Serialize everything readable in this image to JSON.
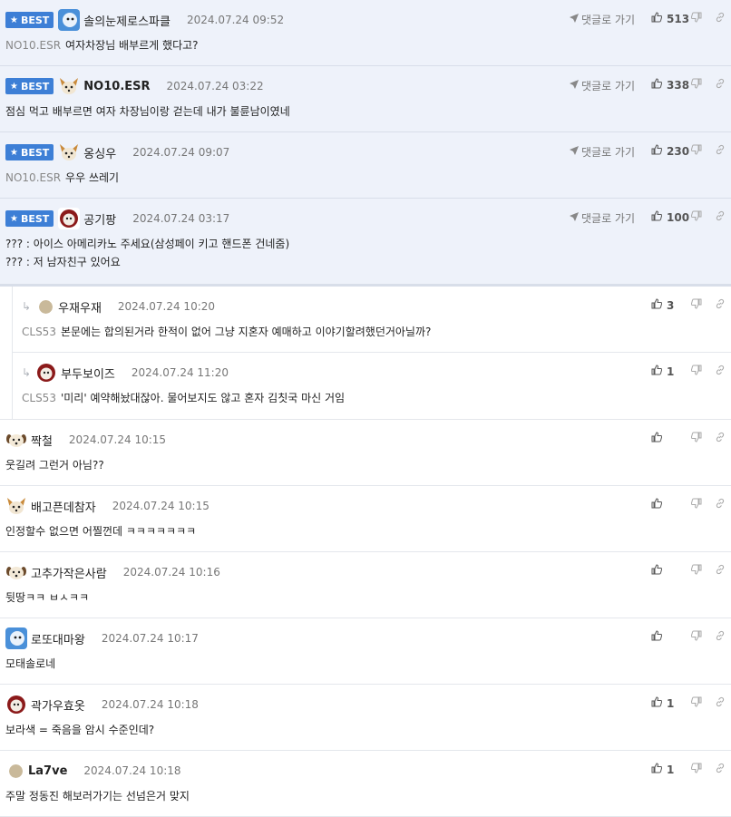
{
  "best_badge": "BEST",
  "reply_link_label": "댓글로 가기",
  "comments": [
    {
      "best": true,
      "nick": "솔의눈제로스파클",
      "date": "2024.07.24 09:52",
      "likes": "513",
      "to": "NO10.ESR",
      "lines": [
        "여자차장님 배부르게 했다고?"
      ],
      "avatar": "blue"
    },
    {
      "best": true,
      "nick": "NO10.ESR",
      "date": "2024.07.24 03:22",
      "likes": "338",
      "to": "",
      "lines": [
        "점심 먹고 배부르면 여자 차장님이랑 걷는데 내가 불륜남이였네"
      ],
      "avatar": "fox"
    },
    {
      "best": true,
      "nick": "옹싱우",
      "date": "2024.07.24 09:07",
      "likes": "230",
      "to": "NO10.ESR",
      "lines": [
        "우우 쓰레기"
      ],
      "avatar": "fox"
    },
    {
      "best": true,
      "nick": "공기팡",
      "date": "2024.07.24 03:17",
      "likes": "100",
      "to": "",
      "lines": [
        "??? : 아이스 아메리카노 주세요(삼성페이 키고 핸드폰 건네줌)",
        "??? : 저 남자친구 있어요"
      ],
      "avatar": "red"
    }
  ],
  "replies": [
    {
      "nick": "우재우재",
      "date": "2024.07.24 10:20",
      "likes": "3",
      "to": "CLS53",
      "text": "본문에는 합의된거라 한적이 없어 그냥 지혼자 예매하고 이야기할려했던거아닐까?",
      "avatar": "dot"
    },
    {
      "nick": "부두보이즈",
      "date": "2024.07.24 11:20",
      "likes": "1",
      "to": "CLS53",
      "text": "'미리' 예약해놨대잖아. 물어보지도 않고 혼자 김칫국 마신 거임",
      "avatar": "red"
    }
  ],
  "normal": [
    {
      "nick": "짝철",
      "date": "2024.07.24 10:15",
      "likes": "",
      "text": "웃길려 그런거 아님??",
      "avatar": "dog"
    },
    {
      "nick": "배고픈데참자",
      "date": "2024.07.24 10:15",
      "likes": "",
      "text": "인정할수 없으면 어찔껀데 ㅋㅋㅋㅋㅋㅋㅋ",
      "avatar": "fox"
    },
    {
      "nick": "고추가작은사람",
      "date": "2024.07.24 10:16",
      "likes": "",
      "text": "뒷땅ㅋㅋ ㅂㅅㅋㅋ",
      "avatar": "dog"
    },
    {
      "nick": "로또대마왕",
      "date": "2024.07.24 10:17",
      "likes": "",
      "text": "모태솔로네",
      "avatar": "blue"
    },
    {
      "nick": "곽가우효옷",
      "date": "2024.07.24 10:18",
      "likes": "1",
      "text": "보라색 = 죽음을 암시 수준인데?",
      "avatar": "red"
    },
    {
      "nick": "La7ve",
      "date": "2024.07.24 10:18",
      "likes": "1",
      "text": "주말 정동진 해보러가기는 선넘은거 맞지",
      "avatar": "dot",
      "bold": true
    }
  ],
  "icons": {
    "like": "thumbs-up-icon",
    "dislike": "thumbs-down-icon",
    "link": "link-icon",
    "reply_arrow": "reply-arrow-icon",
    "send": "send-icon"
  },
  "colors": {
    "badge": "#3d7fd6",
    "best_bg": "#eef2fa"
  }
}
